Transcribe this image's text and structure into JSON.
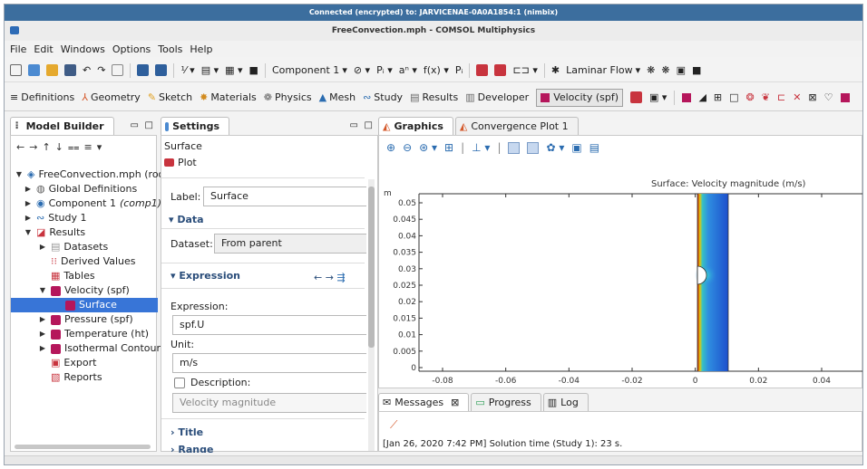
{
  "vnc_bar": "Connected (encrypted) to: JARVICENAE-0A0A1854:1 (nimbix)",
  "window_title": "FreeConvection.mph - COMSOL Multiphysics",
  "menu": [
    "File",
    "Edit",
    "Windows",
    "Options",
    "Tools",
    "Help"
  ],
  "toolbar1": {
    "component": "Component 1",
    "physics": "Laminar Flow"
  },
  "ribbon": {
    "definitions": "Definitions",
    "geometry": "Geometry",
    "sketch": "Sketch",
    "materials": "Materials",
    "physics": "Physics",
    "mesh": "Mesh",
    "study": "Study",
    "results": "Results",
    "developer": "Developer",
    "velocity": "Velocity (spf)"
  },
  "model_builder": {
    "title": "Model Builder",
    "items": [
      {
        "label": "FreeConvection.mph (root",
        "depth": 0
      },
      {
        "label": "Global Definitions",
        "depth": 1
      },
      {
        "label": "Component 1",
        "suffix": "(comp1)",
        "depth": 1
      },
      {
        "label": "Study 1",
        "depth": 1
      },
      {
        "label": "Results",
        "depth": 1
      },
      {
        "label": "Datasets",
        "depth": 2
      },
      {
        "label": "Derived Values",
        "depth": 2
      },
      {
        "label": "Tables",
        "depth": 2
      },
      {
        "label": "Velocity (spf)",
        "depth": 2
      },
      {
        "label": "Surface",
        "depth": 3
      },
      {
        "label": "Pressure (spf)",
        "depth": 2
      },
      {
        "label": "Temperature (ht)",
        "depth": 2
      },
      {
        "label": "Isothermal Contours",
        "depth": 2
      },
      {
        "label": "Export",
        "depth": 2
      },
      {
        "label": "Reports",
        "depth": 2
      }
    ]
  },
  "settings": {
    "title": "Settings",
    "subtitle": "Surface",
    "plot_button": "Plot",
    "label_caption": "Label:",
    "label_value": "Surface",
    "data_section": "Data",
    "dataset_caption": "Dataset:",
    "dataset_value": "From parent",
    "expression_section": "Expression",
    "expression_caption": "Expression:",
    "expression_value": "spf.U",
    "unit_caption": "Unit:",
    "unit_value": "m/s",
    "description_caption": "Description:",
    "description_value": "Velocity magnitude",
    "title_section": "Title",
    "range_section": "Range"
  },
  "graphics": {
    "tabs": [
      "Graphics",
      "Convergence Plot 1"
    ],
    "plot_title": "Surface: Velocity magnitude (m/s)",
    "y_unit": "m",
    "y_ticks": [
      "0.05",
      "0.045",
      "0.04",
      "0.035",
      "0.03",
      "0.025",
      "0.02",
      "0.015",
      "0.01",
      "0.005",
      "0"
    ],
    "x_ticks": [
      "-0.08",
      "-0.06",
      "-0.04",
      "-0.02",
      "0",
      "0.02",
      "0.04"
    ]
  },
  "messages": {
    "tabs": [
      "Messages",
      "Progress",
      "Log"
    ],
    "log_line": "[Jan 26, 2020 7:42 PM] Solution time (Study 1): 23 s."
  },
  "colors": {
    "vnc": "#3c6e9e",
    "selection": "#3875d7",
    "plot_accent": "#b5165b"
  }
}
